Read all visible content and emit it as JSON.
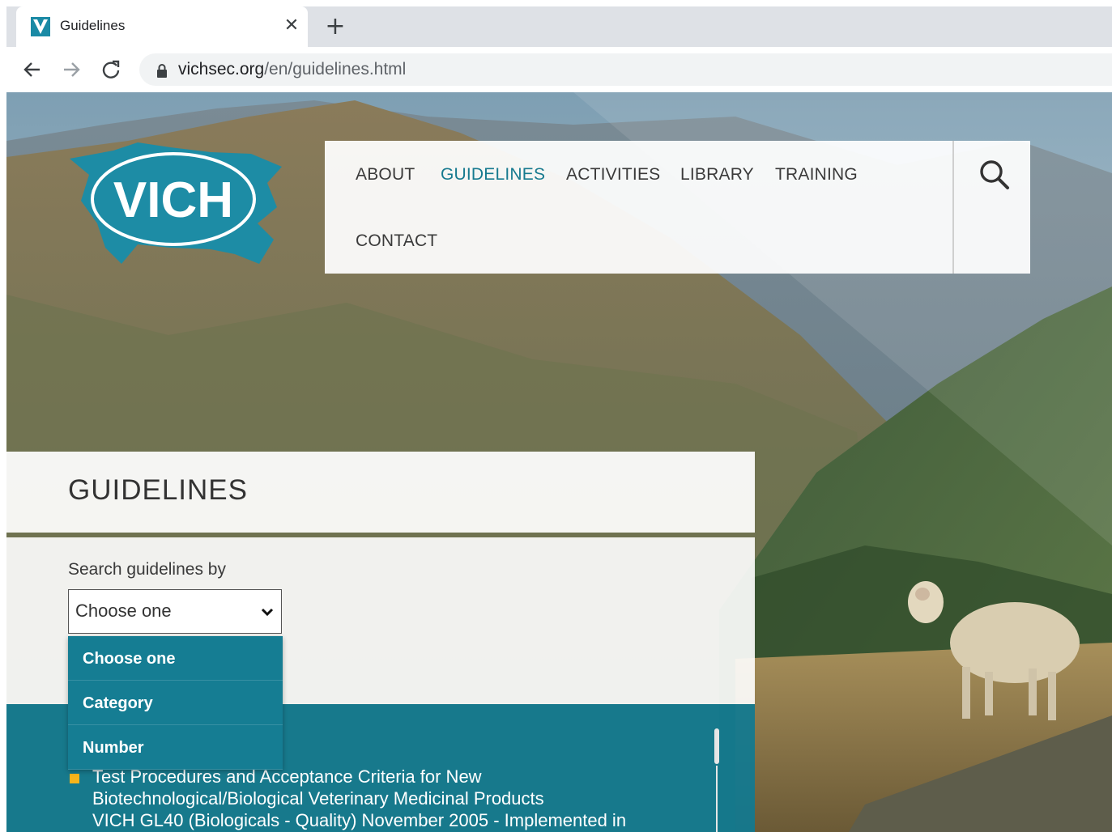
{
  "browser": {
    "tab": {
      "title": "Guidelines",
      "favicon": "vich-v-icon"
    },
    "address": {
      "host": "vichsec.org",
      "path": "/en/guidelines.html"
    }
  },
  "site": {
    "logo_text": "VICH",
    "nav": [
      {
        "label": "ABOUT",
        "active": false
      },
      {
        "label": "GUIDELINES",
        "active": true
      },
      {
        "label": "ACTIVITIES",
        "active": false
      },
      {
        "label": "LIBRARY",
        "active": false
      },
      {
        "label": "TRAINING",
        "active": false
      },
      {
        "label": "CONTACT",
        "active": false
      }
    ]
  },
  "page": {
    "heading": "GUIDELINES",
    "search": {
      "label": "Search guidelines by",
      "selected": "Choose one",
      "options": [
        "Choose one",
        "Category",
        "Number"
      ]
    },
    "results": [
      {
        "lines": [
          "Test Procedures and Acceptance Criteria for New",
          "Biotechnological/Biological Veterinary Medicinal Products",
          "VICH GL40 (Biologicals - Quality) November 2005 - Implemented in"
        ]
      }
    ]
  },
  "colors": {
    "accent": "#177a8f",
    "panel_teal": "#107a91",
    "bullet": "#f7b41b"
  }
}
